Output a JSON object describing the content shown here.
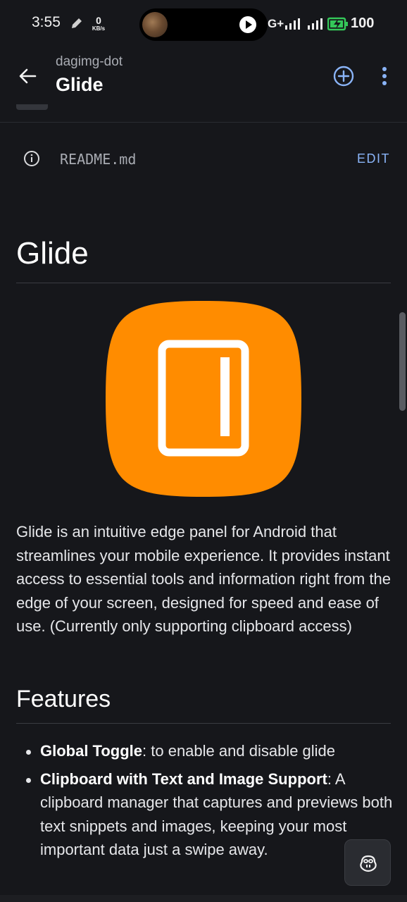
{
  "status_bar": {
    "time": "3:55",
    "net_speed_value": "0",
    "net_speed_unit": "KB/s",
    "network_type": "G+",
    "battery_percent": "100"
  },
  "app_bar": {
    "owner": "dagimg-dot",
    "repo": "Glide"
  },
  "readme_bar": {
    "file_name": "README.md",
    "edit_label": "EDIT"
  },
  "readme": {
    "title": "Glide",
    "intro": "Glide is an intuitive edge panel for Android that streamlines your mobile experience. It provides instant access to essential tools and information right from the edge of your screen, designed for speed and ease of use. (Currently only supporting clipboard access)",
    "features_heading": "Features",
    "features": [
      {
        "name": "Global Toggle",
        "desc": ": to enable and disable glide"
      },
      {
        "name": "Clipboard with Text and Image Support",
        "desc": ": A clipboard manager that captures and previews both text snippets and images, keeping your most important data just a swipe away."
      }
    ]
  },
  "colors": {
    "background": "#16171b",
    "accent_blue": "#8ab4f8",
    "logo_orange": "#ff8c00",
    "battery_green": "#34c759"
  },
  "icons": {
    "back": "arrow-left-icon",
    "add": "plus-circle-icon",
    "more": "more-vert-icon",
    "info": "info-icon",
    "copilot": "copilot-icon",
    "logo": "glide-logo"
  }
}
